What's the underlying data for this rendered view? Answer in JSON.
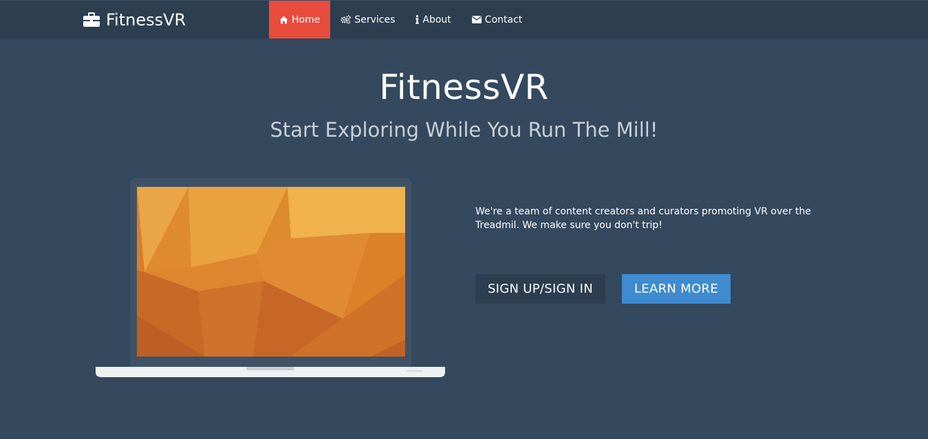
{
  "brand": {
    "name": "FitnessVR",
    "icon": "briefcase-icon"
  },
  "nav": {
    "items": [
      {
        "label": "Home",
        "icon": "home-icon",
        "active": true
      },
      {
        "label": "Services",
        "icon": "gears-icon",
        "active": false
      },
      {
        "label": "About",
        "icon": "info-icon",
        "active": false
      },
      {
        "label": "Contact",
        "icon": "envelope-icon",
        "active": false
      }
    ]
  },
  "hero": {
    "title": "FitnessVR",
    "subtitle": "Start Exploring While You Run The Mill!",
    "intro": "We're a team of content creators and curators promoting VR over the Treadmil. We make sure you don't trip!",
    "signup_label": "SIGN UP/SIGN IN",
    "learn_more_label": "LEARN MORE"
  },
  "colors": {
    "background": "#34495e",
    "navbar": "#2c3e50",
    "active_nav": "#e74c3c",
    "learn_more": "#3e8bd0",
    "signup": "#2c3e50"
  }
}
